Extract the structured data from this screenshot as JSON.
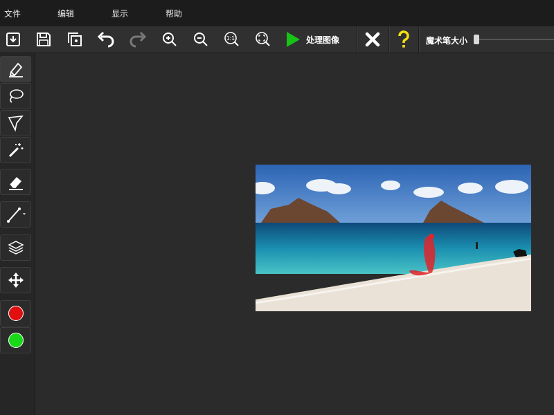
{
  "menu": {
    "items": [
      {
        "label": "文件"
      },
      {
        "label": "编辑"
      },
      {
        "label": "显示"
      },
      {
        "label": "帮助"
      }
    ]
  },
  "toolbar": {
    "buttons": [
      {
        "name": "open-icon"
      },
      {
        "name": "save-icon"
      },
      {
        "name": "preview-icon"
      },
      {
        "name": "undo-icon"
      },
      {
        "name": "redo-icon"
      },
      {
        "name": "zoom-in-icon"
      },
      {
        "name": "zoom-out-icon"
      },
      {
        "name": "zoom-actual-icon",
        "text": "1:1"
      },
      {
        "name": "zoom-fit-icon"
      }
    ],
    "process_label": "处理图像",
    "brush_size_label": "魔术笔大小",
    "brush_size_level": 0.0
  },
  "tools": [
    {
      "name": "marker-icon",
      "active": true
    },
    {
      "name": "lasso-icon"
    },
    {
      "name": "polygon-lasso-icon"
    },
    {
      "name": "magic-wand-icon"
    },
    {
      "name": "eraser-icon"
    },
    {
      "name": "line-icon"
    },
    {
      "name": "layers-icon"
    },
    {
      "name": "move-icon"
    }
  ],
  "colors": {
    "remove": "#e01010",
    "keep": "#18d818",
    "accent_green": "#17c317",
    "help_yellow": "#f2e010"
  }
}
